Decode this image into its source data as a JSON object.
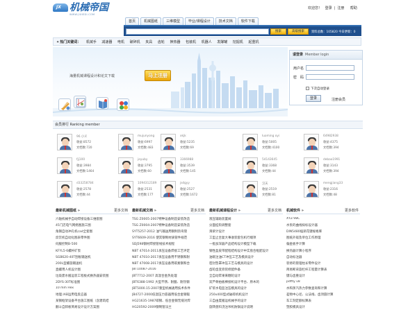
{
  "header": {
    "logo_name": "机械帝国",
    "logo_url": "WWW.JIXIEDI.COM",
    "logo_badge": "JX",
    "welcome": "欢迎您！",
    "login_link": "登录",
    "register_link": "注册",
    "help_link": "帮助"
  },
  "nav": {
    "tabs": [
      "首页",
      "机械图纸",
      "三维模型",
      "毕业/课程设计",
      "技术文档",
      "软件下载"
    ]
  },
  "search": {
    "placeholder": "",
    "search_btn": "搜索",
    "advanced_btn": "高级搜索",
    "stats": "资料总数：105820 今日更新：0"
  },
  "hot": {
    "label": "热门关键词：",
    "keywords": [
      "机械手",
      "减速器",
      "电机",
      "破碎机",
      "夹具",
      "齿轮",
      "换热器",
      "包装机",
      "机器人",
      "发酵罐",
      "挖掘机",
      "起重机"
    ]
  },
  "banner": {
    "tagline": "海量机械课程设计和论文下载",
    "register_btn": "马上注册"
  },
  "login": {
    "title": "请登录",
    "subtitle": "Member login",
    "username_label": "用户名",
    "password_label": "密　码",
    "remember_label": "下次自动登录",
    "login_btn": "登录",
    "register_link": "注册会员"
  },
  "ranking": {
    "title": "会员排行 Ranking member",
    "users": [
      {
        "name": "96.小义",
        "score": "收益:8572",
        "docs": "文档数:720"
      },
      {
        "name": "mujunyong",
        "score": "收益:6997",
        "docs": "文档数:483"
      },
      {
        "name": "xkjk",
        "score": "收益:5235",
        "docs": "文档数:69"
      },
      {
        "name": "luoming  oyi",
        "score": "收益:5005",
        "docs": "文档数:4100"
      },
      {
        "name": "64982938",
        "score": "收益:4375",
        "docs": "文档数:394"
      },
      {
        "name": "fjj100",
        "score": "收益:3984",
        "docs": "文档数:1464"
      },
      {
        "name": "jeyuby",
        "score": "收益:3795",
        "docs": "文档数:60"
      },
      {
        "name": "3366988",
        "score": "收益:3539",
        "docs": "文档数:145"
      },
      {
        "name": "54143645",
        "score": "收益:3368",
        "docs": "文档数:44"
      },
      {
        "name": "debao1991",
        "score": "收益:3143",
        "docs": "文档数:394"
      },
      {
        "name": "d33258784",
        "score": "收益:2578",
        "docs": "文档数:44"
      },
      {
        "name": "1094312189",
        "score": "收益:2531",
        "docs": "文档数:177"
      },
      {
        "name": "jsdgyy",
        "score": "收益:2527",
        "docs": "文档数:1672"
      },
      {
        "name": "汉天",
        "score": "收益:2519",
        "docs": "文档数:81"
      },
      {
        "name": "mengjiang33",
        "score": "收益:2316",
        "docs": "文档数:48"
      }
    ]
  },
  "columns": [
    {
      "title": "最新机械图纸 »",
      "more": "更多文档",
      "items": [
        "六轴机械手自动焊接设备三维套图",
        "45门店电气网络图施工图",
        "角钢自动冲孔机cad全套图",
        "炊饮机自动化图表零件图",
        "伺服控制B-500",
        "KFYL5-6螺杆矿泵",
        "SGB620-40T刮板输送机",
        "200L型螺旋输送机",
        "直螺用人机设计图",
        "垃圾废水搬运装工程板式换热器安装图",
        "2DYS-30T标准图",
        "10 mm Hex",
        "地理.IAB运用电反应器",
        "某钢框架设备平台施工图纸（含建筑结",
        "翻斗自卸板简易设计设计方案图"
      ]
    },
    {
      "title": "最新机械文档 »",
      "more": "更多文档",
      "items": [
        "TSG Z0005-2007特种设备制造安装改造",
        "TSG Z0004-2007特种设备制造安装改造",
        "SYT5257-2012 油气输送用钢制热弯管",
        "SYT6609-2016 使其钢制材质管件规范",
        "SDJ598钢材焊接管线技术规程",
        "NBT 47014-2011承压设备焊接工艺评定",
        "NBT 47010-2017承压设备用不锈钢和耐",
        "NBT 47008-2017承压设备用碳素钢和合",
        "JBT10087-2016",
        "JBT7712-2007 高温合金热处理",
        "JBT6388-1992 大型不锈、耐酸、耐热钢",
        "JBT5000.15-2007重型机械通用技术条件",
        "JB4727-2000低温压力容器用低合金钢锻",
        "HG21635-1987碳钢、低合金钢无缝对焊",
        "HG20592-2009钢制管法兰"
      ]
    },
    {
      "title": "最新机械课程设计 »",
      "more": "更多文档",
      "items": [
        "液压辅助装置阀",
        "分面挂钩调整套",
        "滑梁计设计",
        "工型止合复大事收装套包机行端项",
        "一批加深器产品结构设计模型下载",
        "钢性盒皮带配程结构设计中实盘合框配设计",
        "油碗注油CT冲压工艺及模具设计",
        "密封垫罩冲压工艺与模具的设计",
        "齿轮齿变旁装修配件备",
        "全自动苹果来糖轮设计",
        "双芦骨拍板棒接机设计平台、原木的",
        "矿浆水电监注压模具的设计",
        "250x400型式破碎机机设计",
        "三自由度搬运机械手的设计",
        "旋转盘料浇注吊机防锅设计说明"
      ]
    },
    {
      "title": "机械软件 »",
      "more": "更多软件",
      "items": [
        "XYZ-VBC",
        "水泵的曲线拟标设计器",
        "DIN5480插梁花键规格库",
        "图纸外观及单位工作原理",
        "偏金板手计算",
        "换热器计算小程序",
        "自动标注器",
        "装修的管理柱长零件设计",
        "简易断背旋栏杆工程量计算表",
        "键与齿重设计",
        "pdffly v8",
        "水和蒸汽热力参数查询和计算",
        "差物中心坯、公法线、齿顶圆计算",
        "车工刻定额标算表",
        "塑胶模具设计"
      ]
    }
  ]
}
